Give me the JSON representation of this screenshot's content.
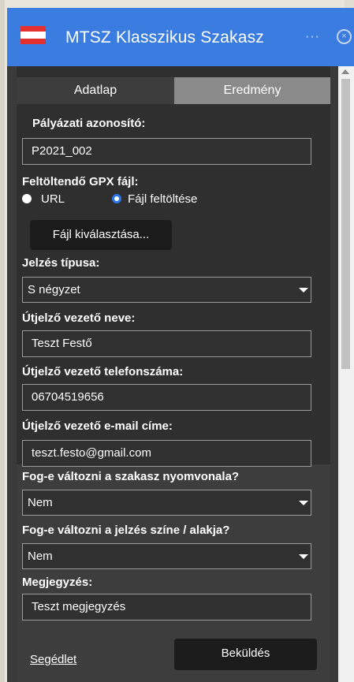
{
  "window": {
    "title": "MTSZ Klasszikus Szakasz",
    "menu_label": "···",
    "close_label": "×",
    "accent_color": "#3b7ce0",
    "flag_colors": [
      "#e53030",
      "#ffffff",
      "#e53030"
    ]
  },
  "tabs": [
    {
      "label": "Adatlap",
      "active": true
    },
    {
      "label": "Eredmény",
      "active": false
    }
  ],
  "form": {
    "application_id": {
      "label": "Pályázati azonosító:",
      "value": "P2021_002"
    },
    "gpx": {
      "label": "Feltöltendő GPX fájl:",
      "options": [
        {
          "label": "URL",
          "selected": false
        },
        {
          "label": "Fájl feltöltése",
          "selected": true
        }
      ],
      "choose_button": "Fájl kiválasztása..."
    },
    "marking_type": {
      "label": "Jelzés típusa:",
      "value": "S négyzet"
    },
    "leader_name": {
      "label": "Útjelző vezető neve:",
      "value": "Teszt Festő"
    },
    "leader_phone": {
      "label": "Útjelző vezető telefonszáma:",
      "value": "06704519656"
    },
    "leader_email": {
      "label": "Útjelző vezető e-mail címe:",
      "value": "teszt.festo@gmail.com"
    },
    "route_change": {
      "label": "Fog-e változni a szakasz nyomvonala?",
      "value": "Nem"
    },
    "marking_change": {
      "label": "Fog-e változni a jelzés színe / alakja?",
      "value": "Nem"
    },
    "comment": {
      "label": "Megjegyzés:",
      "value": "Teszt megjegyzés"
    }
  },
  "footer": {
    "help_link": "Segédlet",
    "submit_button": "Beküldés"
  }
}
